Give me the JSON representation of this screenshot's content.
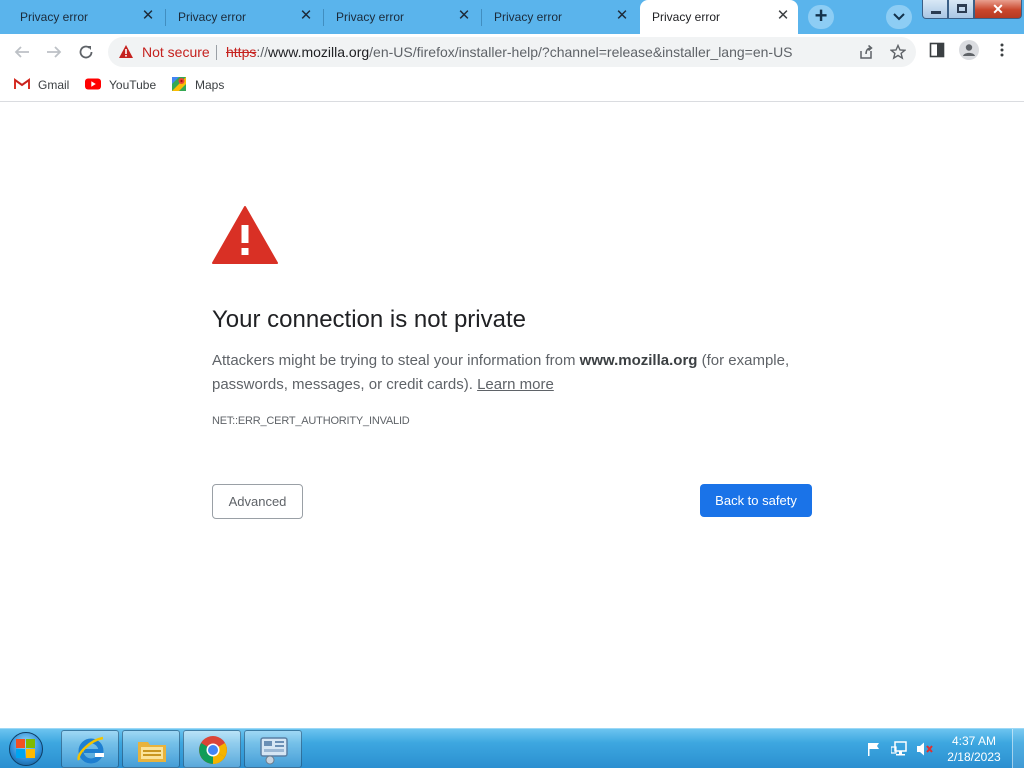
{
  "browser": {
    "tabs": [
      {
        "title": "Privacy error",
        "active": false
      },
      {
        "title": "Privacy error",
        "active": false
      },
      {
        "title": "Privacy error",
        "active": false
      },
      {
        "title": "Privacy error",
        "active": false
      },
      {
        "title": "Privacy error",
        "active": true
      }
    ],
    "new_tab_glyph": "+",
    "tab_close_glyph": "✕",
    "window_close_glyph": "✕"
  },
  "omnibox": {
    "security_label": "Not secure",
    "url_scheme": "https",
    "url_sep": "://",
    "url_host": "www.mozilla.org",
    "url_path": "/en-US/firefox/installer-help/?channel=release&installer_lang=en-US"
  },
  "bookmarks": [
    {
      "label": "Gmail",
      "icon": "gmail-icon"
    },
    {
      "label": "YouTube",
      "icon": "youtube-icon"
    },
    {
      "label": "Maps",
      "icon": "maps-icon"
    }
  ],
  "interstitial": {
    "heading": "Your connection is not private",
    "explanation_prefix": "Attackers might be trying to steal your information from ",
    "explanation_host": "www.mozilla.org",
    "explanation_suffix": " (for example, passwords, messages, or credit cards). ",
    "learn_more": "Learn more",
    "error_code": "NET::ERR_CERT_AUTHORITY_INVALID",
    "advanced_label": "Advanced",
    "back_label": "Back to safety"
  },
  "taskbar": {
    "pinned": [
      "internet-explorer-icon",
      "file-explorer-icon",
      "chrome-icon",
      "control-panel-icon"
    ],
    "time": "4:37 AM",
    "date": "2/18/2023"
  },
  "colors": {
    "tabstrip": "#5ab4ec",
    "danger": "#c5221f",
    "warning_icon": "#d93025",
    "primary_button": "#1a73e8"
  }
}
